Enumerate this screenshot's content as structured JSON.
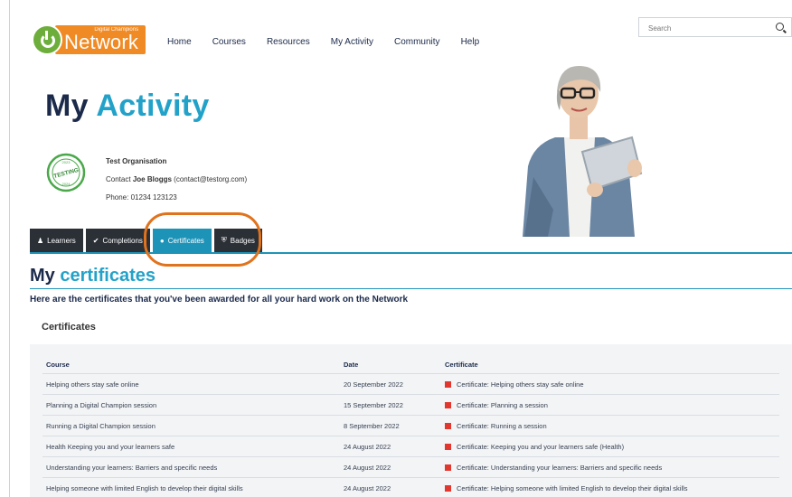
{
  "logo": {
    "small": "Digital Champions",
    "big": "Network"
  },
  "nav": [
    "Home",
    "Courses",
    "Resources",
    "My Activity",
    "Community",
    "Help"
  ],
  "search": {
    "placeholder": "Search"
  },
  "page": {
    "title_1": "My",
    "title_2": "Activity"
  },
  "badge": {
    "top": "2023",
    "middle": "TESTING",
    "bottom": "2024"
  },
  "org": {
    "name": "Test Organisation",
    "contact_prefix": "Contact",
    "contact_name": "Joe Bloggs",
    "contact_email": "(contact@testorg.com)",
    "phone": "Phone: 01234 123123"
  },
  "tabs": [
    {
      "label": "Learners",
      "icon": "user-icon"
    },
    {
      "label": "Completions",
      "icon": "check-icon"
    },
    {
      "label": "Certificates",
      "icon": "dot-icon"
    },
    {
      "label": "Badges",
      "icon": "shield-icon"
    }
  ],
  "section": {
    "title_1": "My",
    "title_2": "certificates",
    "subtitle": "Here are the certificates that you've been awarded for all your hard work on the Network",
    "card_title": "Certificates"
  },
  "table": {
    "headers": [
      "Course",
      "Date",
      "Certificate"
    ],
    "rows": [
      [
        "Helping others stay safe online",
        "20 September 2022",
        "Certificate: Helping others stay safe online"
      ],
      [
        "Planning a Digital Champion session",
        "15 September 2022",
        "Certificate: Planning a session"
      ],
      [
        "Running a Digital Champion session",
        "8 September 2022",
        "Certificate: Running a session"
      ],
      [
        "Health Keeping you and your learners safe",
        "24 August 2022",
        "Certificate: Keeping you and your learners safe (Health)"
      ],
      [
        "Understanding your learners: Barriers and specific needs",
        "24 August 2022",
        "Certificate: Understanding your learners: Barriers and specific needs"
      ],
      [
        "Helping someone with limited English to develop their digital skills",
        "24 August 2022",
        "Certificate: Helping someone with limited English to develop their digital skills"
      ]
    ]
  },
  "colors": {
    "accent": "#23a2c9",
    "active_tab": "#1e93b8",
    "dark_tab": "#2b2f36",
    "brand_orange": "#f08a24",
    "highlight": "#e0731e"
  }
}
